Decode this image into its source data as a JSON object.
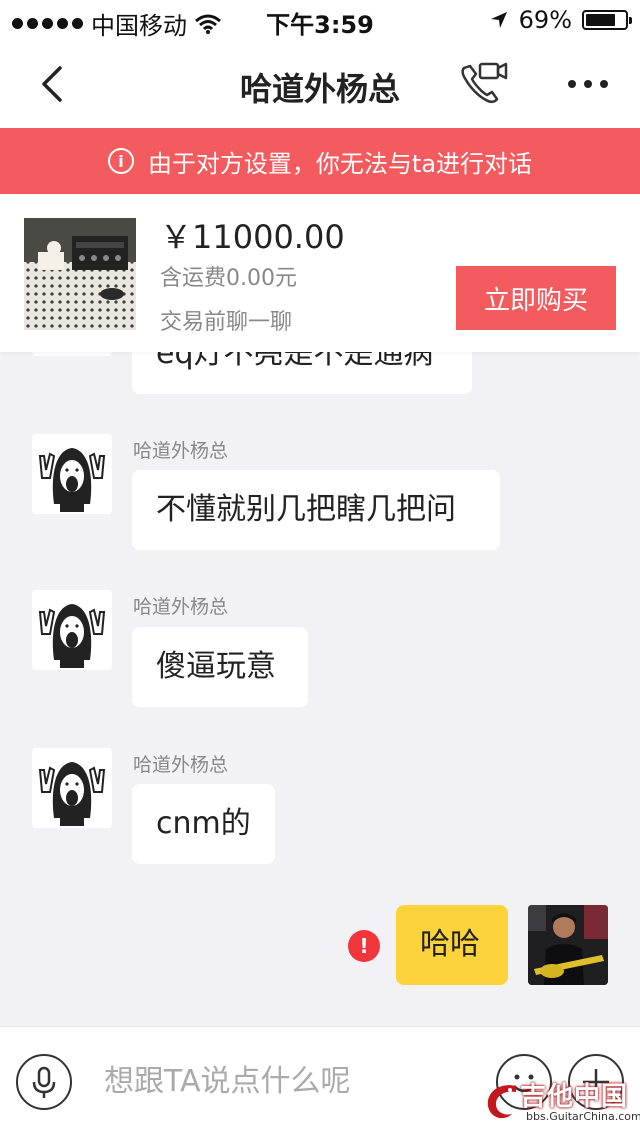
{
  "status_bar": {
    "carrier": "中国移动",
    "time": "下午3:59",
    "battery": "69%"
  },
  "nav": {
    "title": "哈道外杨总"
  },
  "banner": {
    "info_icon": "i",
    "text": "由于对方设置，你无法与ta进行对话"
  },
  "product": {
    "price": "￥11000.00",
    "shipping": "含运费0.00元",
    "chat_hint": "交易前聊一聊",
    "buy_label": "立即购买"
  },
  "messages": [
    {
      "from": "other",
      "sender": "",
      "text": "eq灯不亮是不是通病"
    },
    {
      "from": "other",
      "sender": "哈道外杨总",
      "text": "不懂就别几把瞎几把问"
    },
    {
      "from": "other",
      "sender": "哈道外杨总",
      "text": "傻逼玩意"
    },
    {
      "from": "other",
      "sender": "哈道外杨总",
      "text": "cnm的"
    },
    {
      "from": "me",
      "text": "哈哈",
      "send_failed": true,
      "error_mark": "!"
    }
  ],
  "input": {
    "placeholder": "想跟TA说点什么呢"
  },
  "watermark": {
    "title": "吉他中国",
    "url": "bbs.GuitarChina.com"
  },
  "colors": {
    "accent_red": "#f45b5e",
    "my_bubble": "#fdd33b",
    "error_red": "#f0353b"
  }
}
